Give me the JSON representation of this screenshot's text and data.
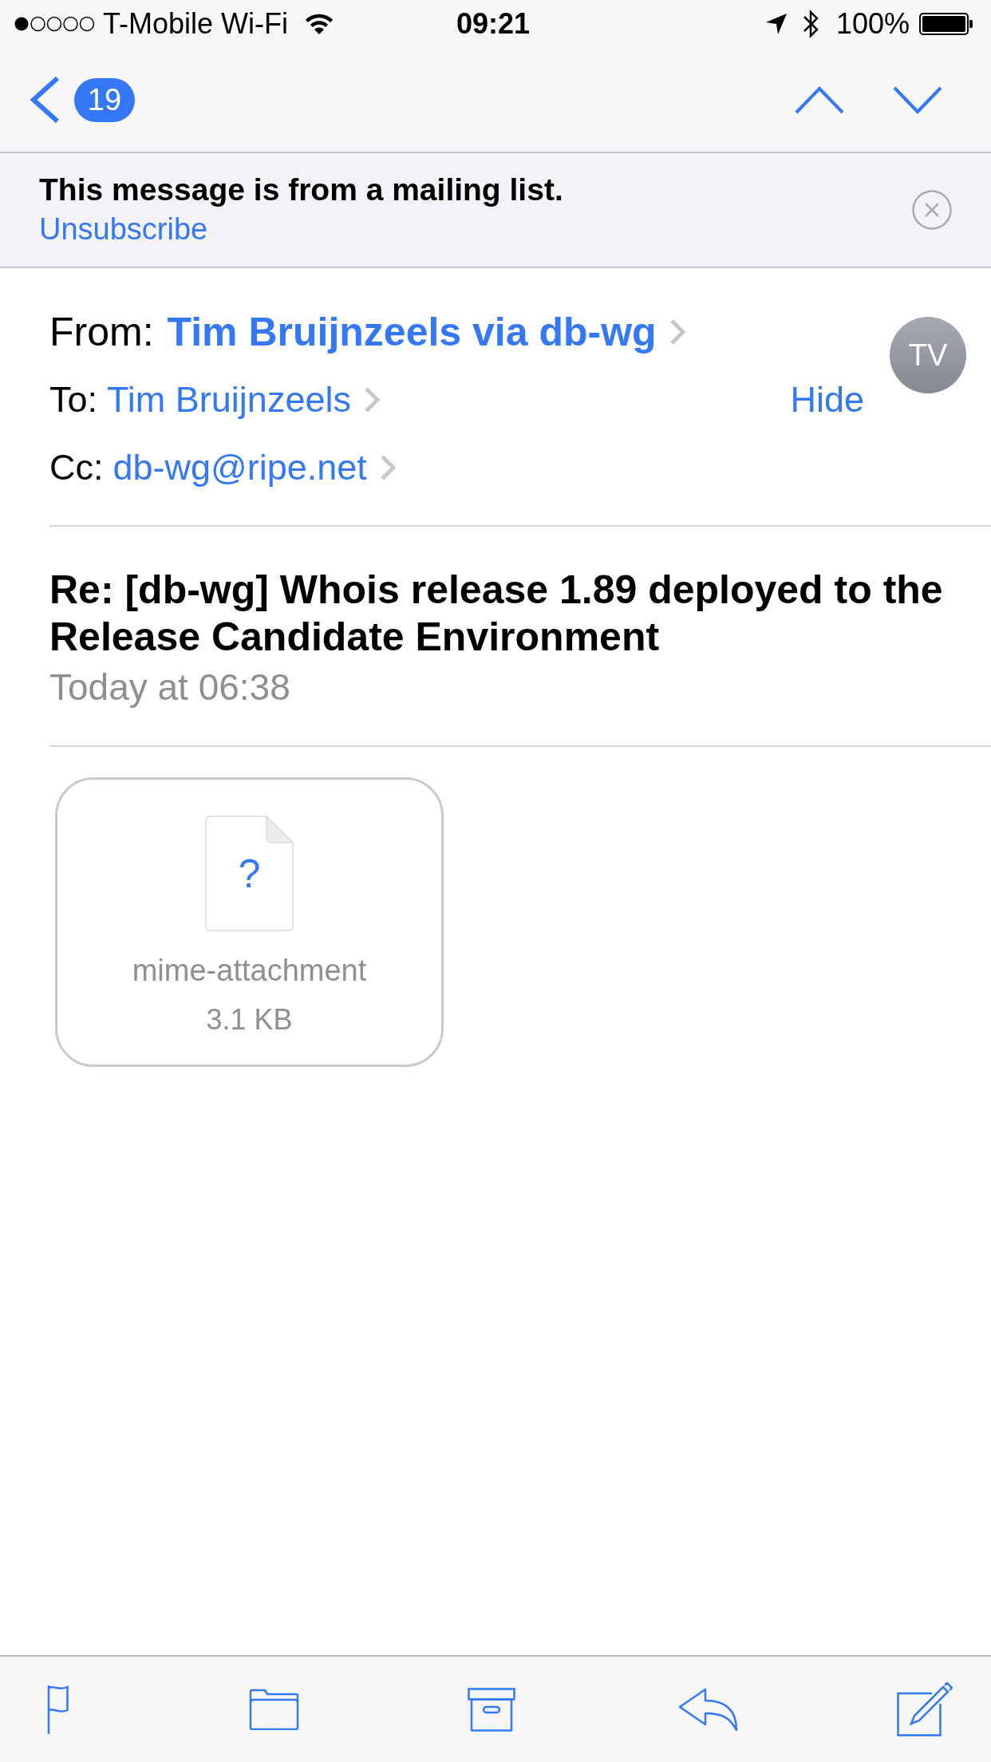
{
  "status_bar": {
    "carrier": "T-Mobile Wi-Fi",
    "time": "09:21",
    "battery": "100%"
  },
  "nav_bar": {
    "unread_count": "19"
  },
  "mailing_list_banner": {
    "message": "This message is from a mailing list.",
    "action": "Unsubscribe"
  },
  "header": {
    "fields": [
      {
        "kind": "sender",
        "label": "From:",
        "value": "Tim Bruijnzeels via db-wg"
      },
      {
        "kind": "recipient",
        "label": "To:",
        "value": "Tim Bruijnzeels",
        "action": "Hide"
      },
      {
        "kind": "recipient",
        "label": "Cc:",
        "value": "db-wg@ripe.net"
      }
    ],
    "avatar_initials": "TV"
  },
  "message": {
    "subject": "Re: [db-wg] Whois release 1.89 deployed to the Release Candidate Environment",
    "date": "Today at 06:38"
  },
  "attachments": [
    {
      "icon_glyph": "?",
      "name": "mime-attachment",
      "size": "3.1 KB"
    }
  ]
}
